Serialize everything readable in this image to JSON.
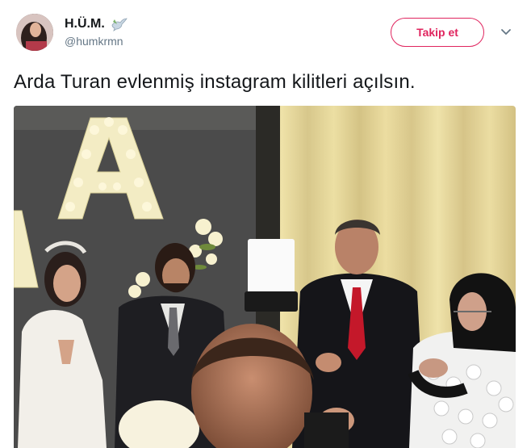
{
  "user": {
    "display_name": "H.Ü.M.",
    "handle": "@humkrmn",
    "avatar_icon": "profile-photo",
    "badge_icon": "dove-icon"
  },
  "actions": {
    "follow_label": "Takip et",
    "menu_icon": "chevron-down-icon"
  },
  "tweet": {
    "text": "Arda Turan evlenmiş instagram kilitleri açılsın."
  },
  "media": {
    "type": "photo"
  },
  "colors": {
    "accent": "#e0245e",
    "text": "#14171a",
    "secondary": "#657786"
  }
}
